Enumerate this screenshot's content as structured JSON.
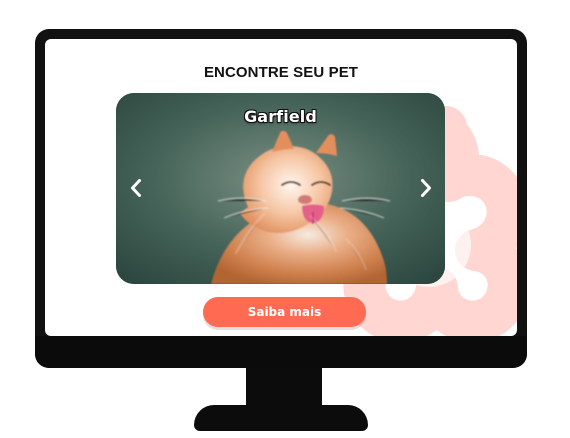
{
  "section": {
    "title": "ENCONTRE SEU PET"
  },
  "carousel": {
    "current_pet_name": "Garfield",
    "prev_label": "‹",
    "next_label": "›"
  },
  "cta": {
    "label": "Saiba mais"
  },
  "colors": {
    "accent": "#ff6b52",
    "monitor": "#111111",
    "background_paw": "#ffd2cc"
  },
  "icons": {
    "left": "chevron-left-icon",
    "right": "chevron-right-icon",
    "background": "paw-flower-icon"
  }
}
